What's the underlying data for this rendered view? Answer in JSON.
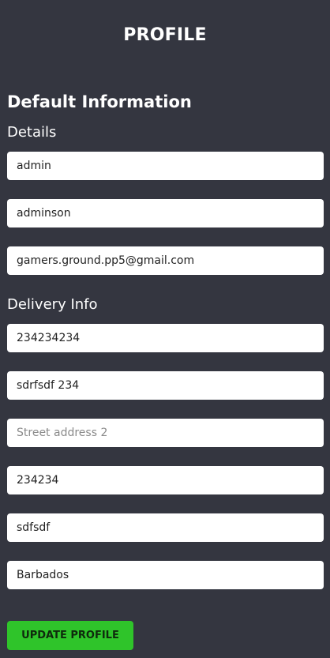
{
  "header": {
    "title": "PROFILE"
  },
  "section": {
    "title": "Default Information"
  },
  "details": {
    "title": "Details",
    "first_name": {
      "value": "admin",
      "placeholder": ""
    },
    "last_name": {
      "value": "adminson",
      "placeholder": ""
    },
    "email": {
      "value": "gamers.ground.pp5@gmail.com",
      "placeholder": ""
    }
  },
  "delivery": {
    "title": "Delivery Info",
    "phone": {
      "value": "234234234",
      "placeholder": ""
    },
    "street_address_1": {
      "value": "sdrfsdf 234",
      "placeholder": ""
    },
    "street_address_2": {
      "value": "",
      "placeholder": "Street address 2"
    },
    "postcode": {
      "value": "234234",
      "placeholder": ""
    },
    "town_or_city": {
      "value": "sdfsdf",
      "placeholder": ""
    },
    "country": {
      "value": "Barbados",
      "placeholder": ""
    }
  },
  "actions": {
    "update_label": "UPDATE PROFILE"
  },
  "colors": {
    "background": "#343640",
    "field_background": "#ffffff",
    "button": "#2fc42a"
  }
}
